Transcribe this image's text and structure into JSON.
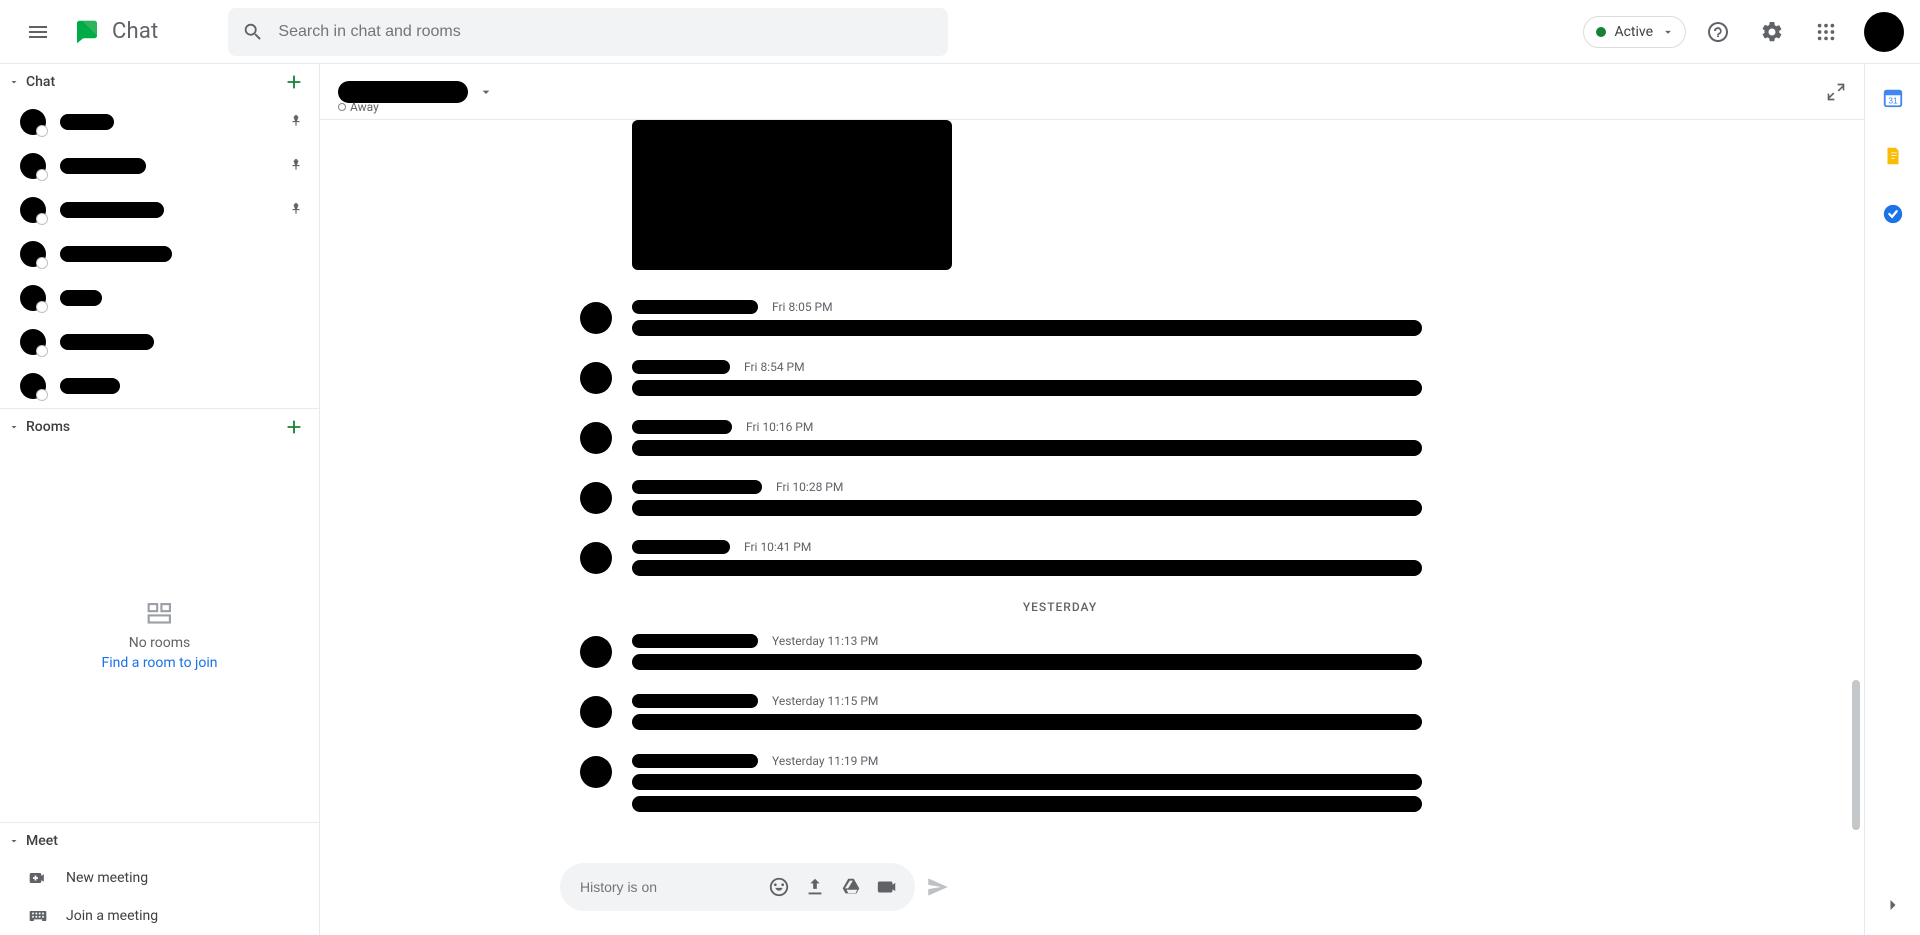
{
  "header": {
    "app_name": "Chat",
    "search_placeholder": "Search in chat and rooms",
    "status_label": "Active"
  },
  "sidebar": {
    "chat_label": "Chat",
    "rooms_label": "Rooms",
    "meet_label": "Meet",
    "chat_items": [
      {
        "name_width": 54,
        "pinned": true
      },
      {
        "name_width": 86,
        "pinned": true
      },
      {
        "name_width": 104,
        "pinned": true
      },
      {
        "name_width": 112,
        "pinned": false
      },
      {
        "name_width": 42,
        "pinned": false
      },
      {
        "name_width": 94,
        "pinned": false
      },
      {
        "name_width": 60,
        "pinned": false
      }
    ],
    "rooms_empty_title": "No rooms",
    "rooms_empty_link": "Find a room to join",
    "meet_items": [
      {
        "label": "New meeting",
        "icon": "video-plus-icon"
      },
      {
        "label": "Join a meeting",
        "icon": "keyboard-icon"
      }
    ]
  },
  "conversation": {
    "status_label": "Away",
    "day_separator": "YESTERDAY",
    "compose_placeholder": "History is on",
    "messages": [
      {
        "sender_width": 126,
        "time": "Fri 8:05 PM",
        "lines": 1
      },
      {
        "sender_width": 98,
        "time": "Fri 8:54 PM",
        "lines": 1
      },
      {
        "sender_width": 100,
        "time": "Fri 10:16 PM",
        "lines": 1
      },
      {
        "sender_width": 130,
        "time": "Fri 10:28 PM",
        "lines": 1
      },
      {
        "sender_width": 98,
        "time": "Fri 10:41 PM",
        "lines": 1
      }
    ],
    "messages_yesterday": [
      {
        "sender_width": 126,
        "time": "Yesterday 11:13 PM",
        "lines": 1
      },
      {
        "sender_width": 126,
        "time": "Yesterday 11:15 PM",
        "lines": 1
      },
      {
        "sender_width": 126,
        "time": "Yesterday 11:19 PM",
        "lines": 2
      }
    ]
  }
}
